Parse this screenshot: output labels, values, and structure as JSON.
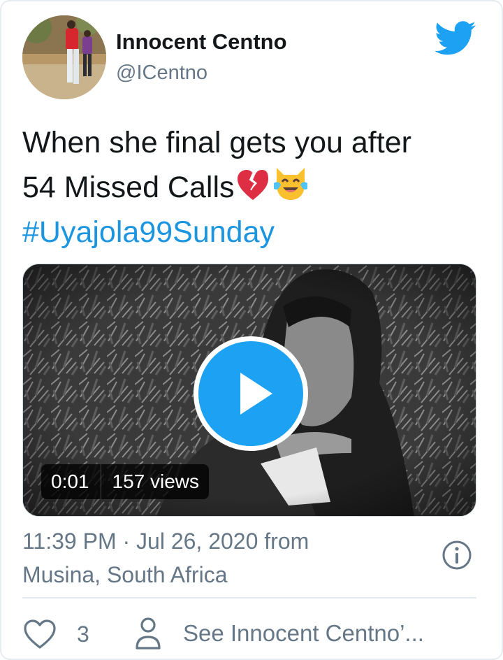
{
  "author": {
    "name": "Innocent Centno",
    "handle": "@ICentno"
  },
  "tweet": {
    "line1": "When she final gets you after",
    "line2": "54 Missed Calls",
    "hashtag": "#Uyajola99Sunday",
    "emojis": [
      "broken-heart-emoji",
      "cat-tears-of-joy-emoji"
    ]
  },
  "video": {
    "duration": "0:01",
    "views": "157 views"
  },
  "meta": {
    "time_line1": "11:39 PM · Jul 26, 2020 from",
    "time_line2": "Musina, South Africa"
  },
  "actions": {
    "like_count": "3",
    "profile_label": "See Innocent Centno’..."
  },
  "colors": {
    "brand": "#1da1f2",
    "link": "#1b95e0",
    "secondary_text": "#657786",
    "divider": "#e1e8ed"
  },
  "icons": [
    "twitter-bird-icon",
    "play-icon",
    "info-icon",
    "heart-icon",
    "person-icon"
  ]
}
